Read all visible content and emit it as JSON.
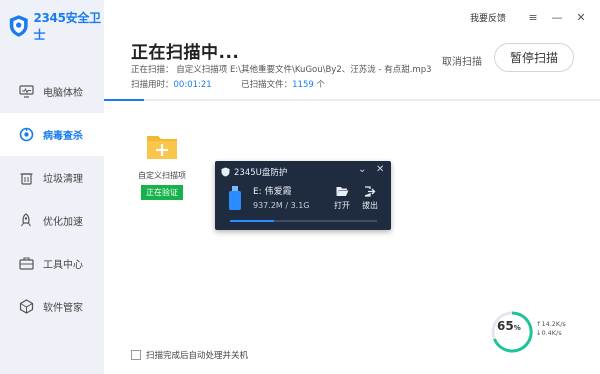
{
  "app": {
    "name": "2345安全卫士"
  },
  "topbar": {
    "feedback": "我要反馈",
    "menu_icon": "≡",
    "minimize_icon": "—",
    "close_icon": "✕"
  },
  "sidebar": {
    "items": [
      {
        "label": "电脑体检",
        "icon": "monitor-icon",
        "active": false
      },
      {
        "label": "病毒查杀",
        "icon": "virus-scan-icon",
        "active": true
      },
      {
        "label": "垃圾清理",
        "icon": "trash-icon",
        "active": false
      },
      {
        "label": "优化加速",
        "icon": "rocket-icon",
        "active": false
      },
      {
        "label": "工具中心",
        "icon": "toolbox-icon",
        "active": false
      },
      {
        "label": "软件管家",
        "icon": "software-icon",
        "active": false
      }
    ]
  },
  "scan": {
    "title": "正在扫描中...",
    "scanning_label": "正在扫描：",
    "scanning_type": "自定义扫描项",
    "scanning_path": "E:\\其他重要文件\\KuGou\\By2、汪苏泷 - 有点甜.mp3",
    "time_label": "扫描用时：",
    "time_value": "00:01:21",
    "files_label": "已扫描文件：",
    "files_value": "1159",
    "files_unit": "个",
    "cancel_label": "取消扫描",
    "pause_label": "暂停扫描",
    "progress": 0.08
  },
  "card": {
    "label": "自定义扫描项",
    "badge": "正在验证"
  },
  "popup": {
    "title": "2345U盘防护",
    "drive_name": "E:  伟爱霞",
    "drive_size": "937.2M / 3.1G",
    "open_label": "打开",
    "eject_label": "拔出",
    "usage": 0.3
  },
  "bottom": {
    "auto_shutdown_label": "扫描完成后自动处理并关机"
  },
  "status": {
    "percent": "65",
    "speed_up": "14.2K/s",
    "speed_down": "0.4K/s"
  },
  "colors": {
    "accent": "#1a7cf0",
    "badge": "#16b24b",
    "popup_bg": "#1f2c3f"
  }
}
